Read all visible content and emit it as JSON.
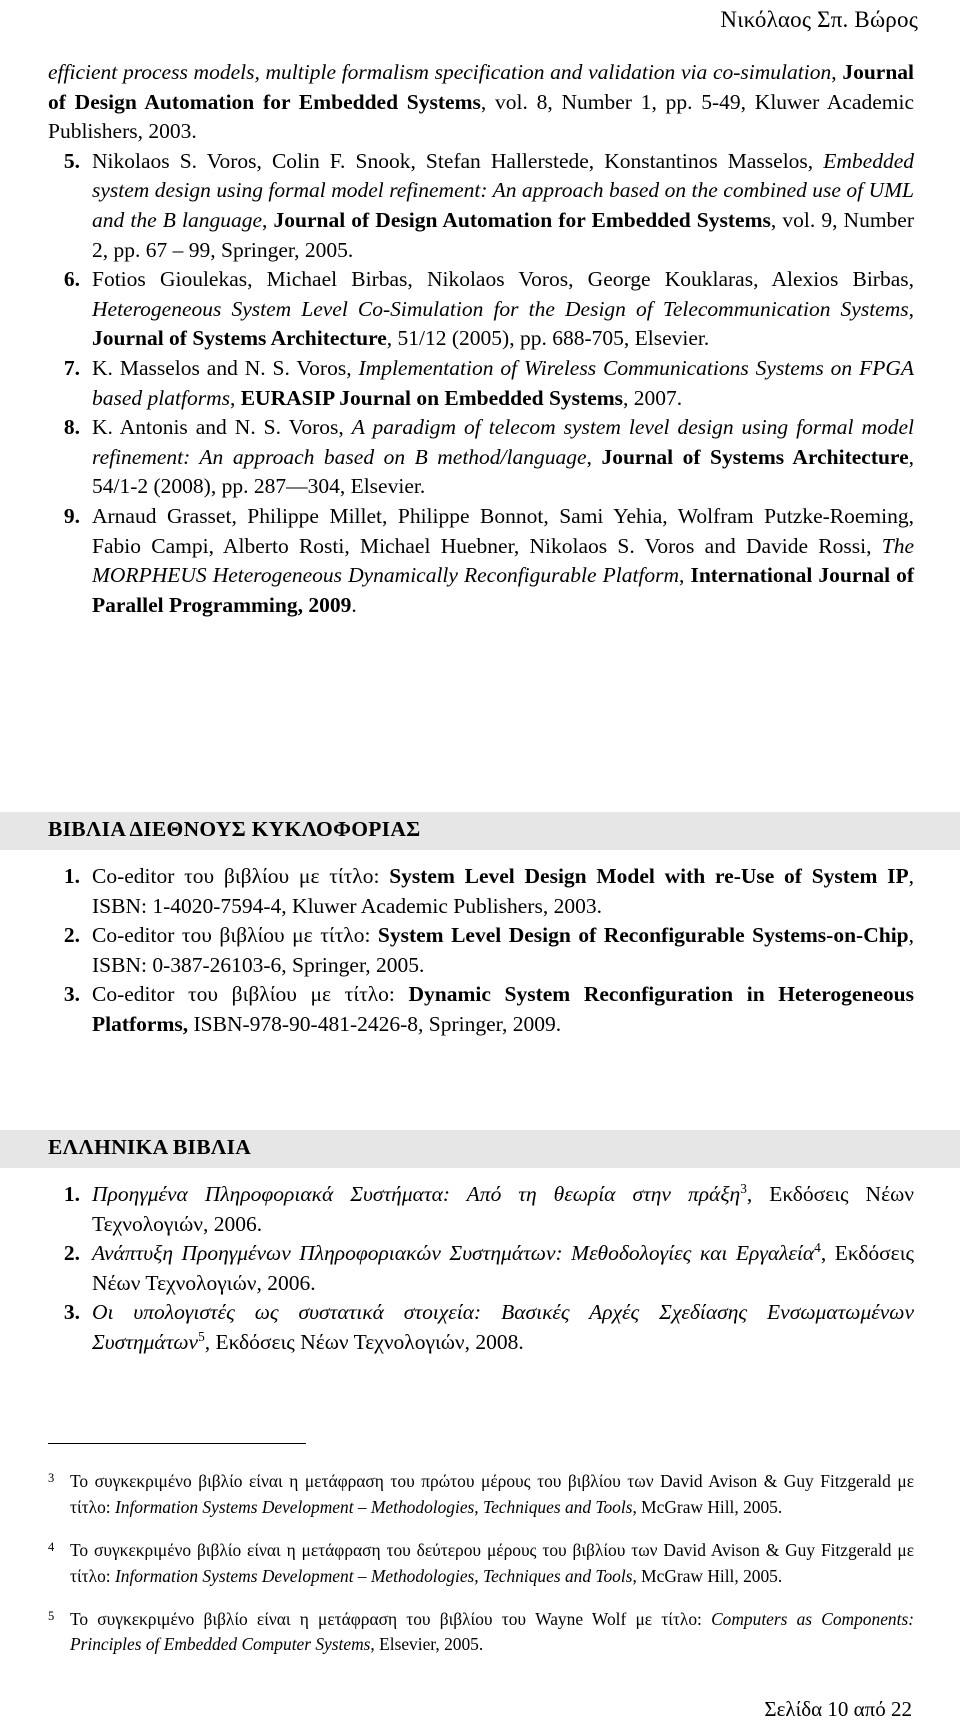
{
  "header": {
    "running_title": "Νικόλαος Σπ. Βώρος"
  },
  "main": {
    "continuation_paragraph": {
      "part1_italic": "efficient process models, multiple formalism specification and validation via co-simulation",
      "sep1": ", ",
      "part2_bold": "Journal of Design Automation for Embedded Systems",
      "part3": ", vol. 8, Number 1, pp. 5-49, Kluwer Academic Publishers, 2003."
    },
    "references": [
      {
        "number": "5.",
        "authors": "Nikolaos S. Voros, Colin F. Snook, Stefan Hallerstede, Konstantinos Masselos, ",
        "title_italic": "Embedded system design using formal model refinement: An approach based on the combined use of UML and the B language",
        "sep": ", ",
        "venue_bold": "Journal of Design Automation for Embedded Systems",
        "tail": ", vol. 9, Number 2, pp. 67 – 99, Springer, 2005."
      },
      {
        "number": "6.",
        "authors": "Fotios Gioulekas, Michael Birbas, Nikolaos Voros, George Kouklaras, Alexios Birbas, ",
        "title_italic": "Heterogeneous System Level Co-Simulation for the Design of Telecommunication Systems",
        "sep": ", ",
        "venue_bold": "Journal of Systems Architecture",
        "tail": ", 51/12 (2005), pp. 688-705, Elsevier."
      },
      {
        "number": "7.",
        "authors": "K. Masselos and N. S. Voros, ",
        "title_italic": "Implementation of Wireless Communications Systems on FPGA based platforms",
        "sep": ", ",
        "venue_bold": "EURASIP Journal on Embedded Systems",
        "tail": ", 2007."
      },
      {
        "number": "8.",
        "authors": "K. Antonis and N. S. Voros, ",
        "title_italic": "A paradigm of telecom system level design using formal model refinement: An approach based on B method/language",
        "sep": ", ",
        "venue_bold": "Journal of Systems Architecture",
        "tail": ", 54/1-2 (2008), pp. 287—304, Elsevier."
      },
      {
        "number": "9.",
        "authors": "Arnaud Grasset, Philippe Millet, Philippe Bonnot, Sami Yehia, Wolfram Putzke-Roeming, Fabio Campi, Alberto Rosti, Michael Huebner, Nikolaos S. Voros and Davide Rossi, ",
        "title_italic": "The MORPHEUS Heterogeneous Dynamically Reconfigurable Platform",
        "sep": ", ",
        "venue_bold": "International Journal of Parallel Programming, 2009",
        "tail": "."
      }
    ]
  },
  "section_international_books": {
    "title": "ΒΙΒΛΙΑ ΔΙΕΘΝΟΥΣ ΚΥΚΛΟΦΟΡΙΑΣ",
    "items": [
      {
        "number": "1.",
        "lead": "Co-editor του βιβλίου με τίτλο: ",
        "title_bold": "System Level Design Model with re-Use of System IP",
        "tail": ", ISBN: 1-4020-7594-4, Kluwer Academic Publishers, 2003."
      },
      {
        "number": "2.",
        "lead": "Co-editor του βιβλίου με τίτλο: ",
        "title_bold": "System Level Design of Reconfigurable Systems-on-Chip",
        "tail": ", ISBN: 0-387-26103-6, Springer, 2005."
      },
      {
        "number": "3.",
        "lead": "Co-editor του βιβλίου με τίτλο: ",
        "title_bold": "Dynamic System Reconfiguration in Heterogeneous Platforms,",
        "tail": " ISBN-978-90-481-2426-8, Springer, 2009."
      }
    ]
  },
  "section_greek_books": {
    "title": "ΕΛΛΗΝΙΚΑ ΒΙΒΛΙΑ",
    "items": [
      {
        "number": "1.",
        "title_italic": "Προηγμένα Πληροφοριακά Συστήματα: Από τη θεωρία στην πράξη",
        "footnote_mark": "3",
        "tail": ", Εκδόσεις Νέων Τεχνολογιών, 2006."
      },
      {
        "number": "2.",
        "title_italic": "Ανάπτυξη Προηγμένων Πληροφοριακών Συστημάτων: Μεθοδολογίες και Εργαλεία",
        "footnote_mark": "4",
        "tail": ", Εκδόσεις Νέων Τεχνολογιών, 2006."
      },
      {
        "number": "3.",
        "title_italic": "Οι υπολογιστές ως συστατικά στοιχεία: Βασικές Αρχές Σχεδίασης Ενσωματωμένων Συστημάτων",
        "footnote_mark": "5",
        "tail": ", Εκδόσεις Νέων Τεχνολογιών, 2008."
      }
    ]
  },
  "footnotes": [
    {
      "mark": "3",
      "part1": "Το συγκεκριμένο βιβλίο είναι η μετάφραση του πρώτου μέρους του βιβλίου των David Avison & Guy Fitzgerald με τίτλο: ",
      "title_italic": "Information Systems Development – Methodologies, Techniques and Tools",
      "tail": ", McGraw Hill, 2005."
    },
    {
      "mark": "4",
      "part1": "Το συγκεκριμένο βιβλίο είναι η μετάφραση του δεύτερου μέρους του βιβλίου των David Avison & Guy Fitzgerald με τίτλο: ",
      "title_italic": "Information Systems Development – Methodologies, Techniques and Tools",
      "tail": ", McGraw Hill, 2005."
    },
    {
      "mark": "5",
      "part1": "Το συγκεκριμένο βιβλίο είναι η μετάφραση του βιβλίου του Wayne Wolf με τίτλο: ",
      "title_italic": "Computers as Components: Principles of Embedded Computer Systems",
      "tail": ", Elsevier, 2005."
    }
  ],
  "footer": {
    "page_label": "Σελίδα 10 από 22"
  },
  "style": {
    "band_color": "#e6e6e6",
    "text_color": "#000000",
    "page_background": "#ffffff"
  }
}
